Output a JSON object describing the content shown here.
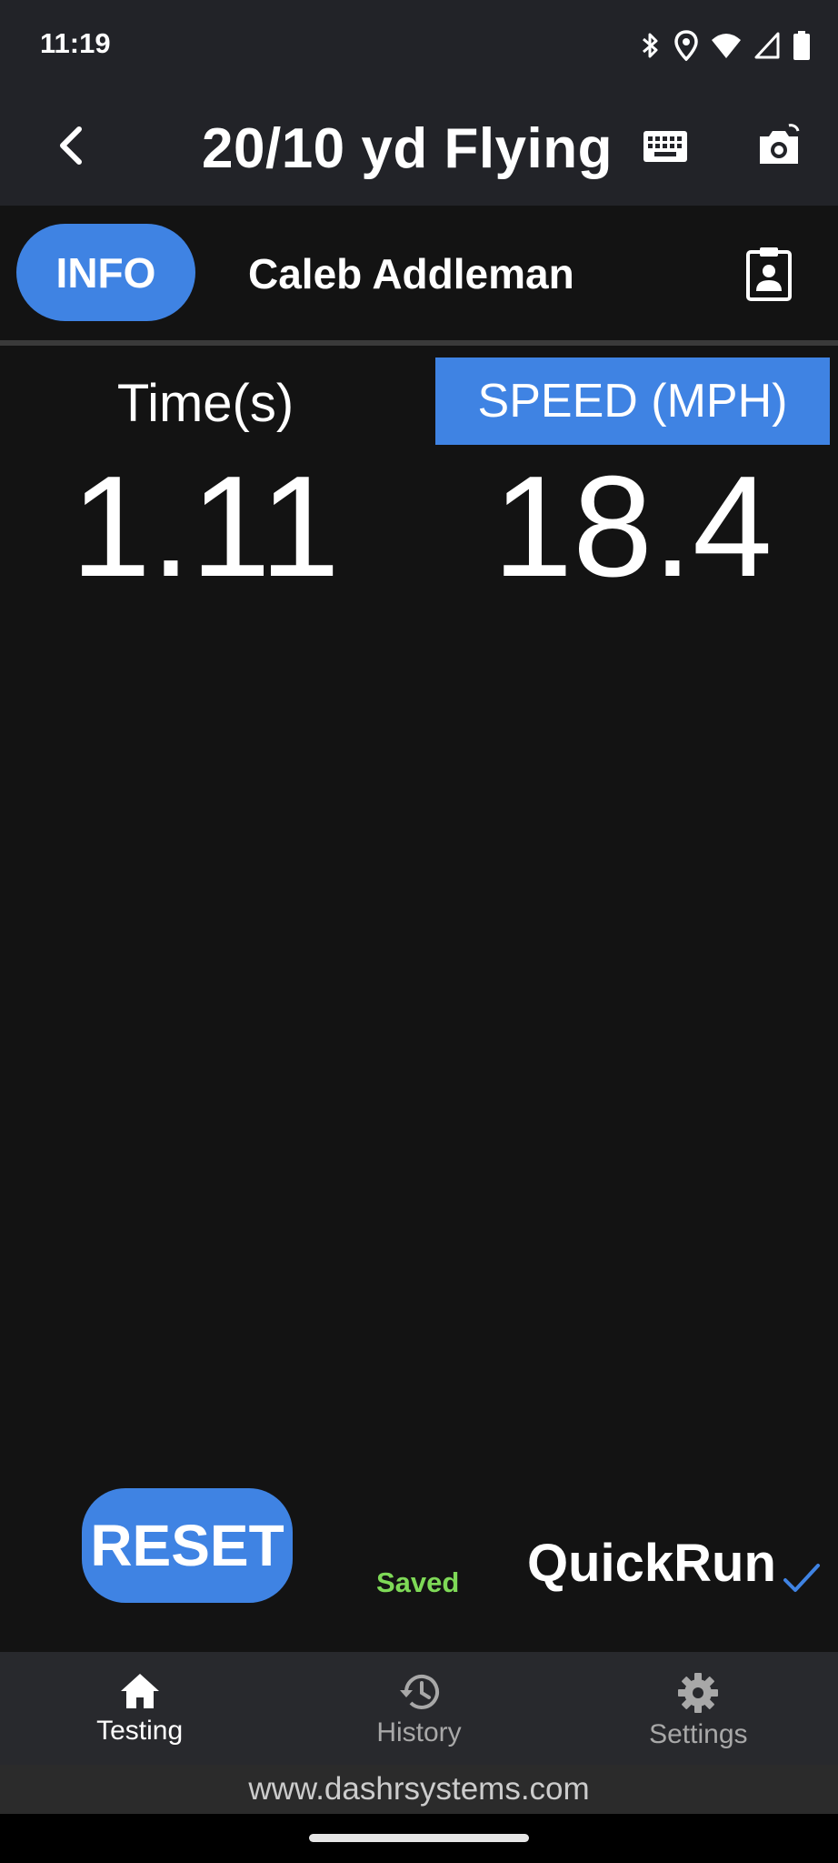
{
  "status_bar": {
    "time": "11:19",
    "icons": [
      "bluetooth-icon",
      "location-icon",
      "wifi-icon",
      "cell-signal-icon",
      "battery-icon"
    ]
  },
  "header": {
    "title": "20/10 yd Flying",
    "icons": [
      "back-arrow-icon",
      "keyboard-icon",
      "camera-switch-icon"
    ]
  },
  "athlete": {
    "info_label": "INFO",
    "name": "Caleb Addleman"
  },
  "metrics": {
    "time_label": "Time(s)",
    "time_value": "1.11",
    "speed_label": "SPEED (MPH)",
    "speed_value": "18.4"
  },
  "controls": {
    "reset_label": "RESET",
    "saved_label": "Saved",
    "quickrun_label": "QuickRun"
  },
  "nav": {
    "items": [
      {
        "label": "Testing",
        "icon": "home-icon",
        "active": true
      },
      {
        "label": "History",
        "icon": "history-icon",
        "active": false
      },
      {
        "label": "Settings",
        "icon": "gear-icon",
        "active": false
      }
    ]
  },
  "footer": {
    "url": "www.dashrsystems.com"
  },
  "colors": {
    "accent": "#3f83e3",
    "saved": "#7ed957",
    "background": "#131313",
    "header_bg": "#222328"
  }
}
